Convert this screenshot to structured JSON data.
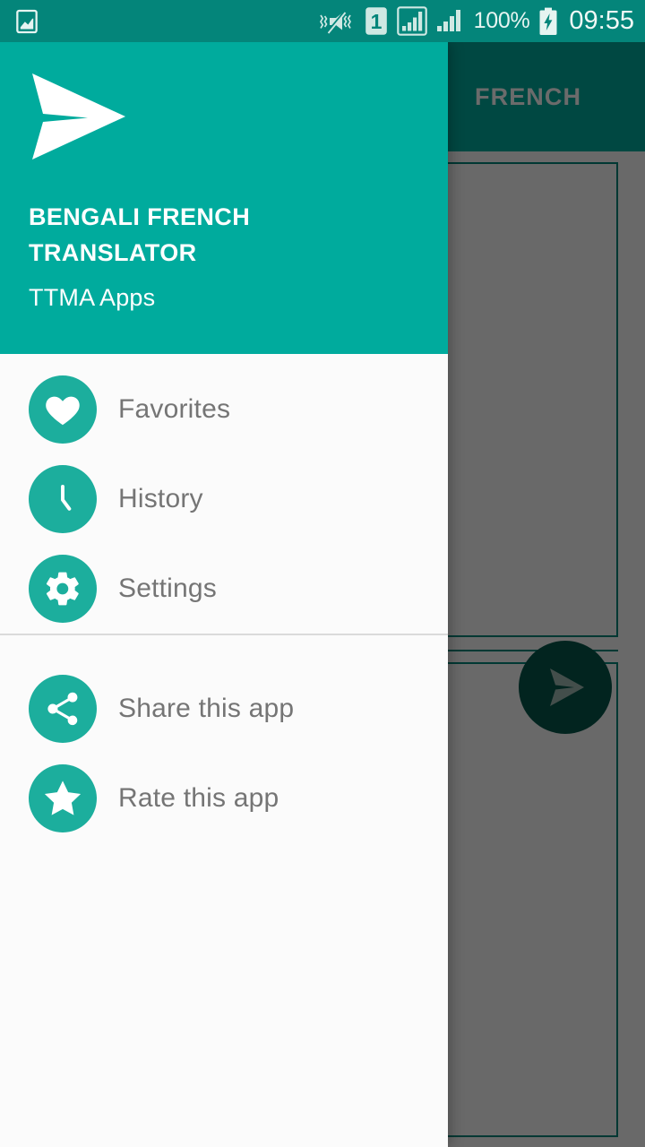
{
  "status_bar": {
    "left_icon": "photo-gallery-icon",
    "icons": [
      "vibrate-mute-icon",
      "sim-1-icon",
      "signal-bars-sim1-icon",
      "signal-bars-sim2-icon"
    ],
    "battery_percent": "100%",
    "battery_icon": "battery-charging-icon",
    "clock": "09:55",
    "background_color": "#04857a",
    "foreground_color": "#e6f4f1"
  },
  "app_bar": {
    "title": "FRENCH",
    "background_color": "#00ab9d",
    "title_color": "#ffffff"
  },
  "main": {
    "source_panel_label": "",
    "target_panel_label": "",
    "fab_icon": "send-paper-plane-icon",
    "fab_color": "#05564a",
    "panel_border_color": "#00857a"
  },
  "scrim": {
    "color": "#000000",
    "opacity": "0.58"
  },
  "drawer": {
    "logo_icon": "send-paper-plane-logo-icon",
    "title": "BENGALI FRENCH TRANSLATOR",
    "subtitle": "TTMA Apps",
    "header_background": "#00ab9d",
    "background": "#fbfbfb",
    "accent_color": "#1cae9d",
    "label_color": "#757575",
    "groups": [
      {
        "items": [
          {
            "label": "Favorites",
            "icon": "heart-icon"
          },
          {
            "label": "History",
            "icon": "clock-icon"
          },
          {
            "label": "Settings",
            "icon": "gear-icon"
          }
        ]
      },
      {
        "items": [
          {
            "label": "Share this app",
            "icon": "share-icon"
          },
          {
            "label": "Rate this app",
            "icon": "star-icon"
          }
        ]
      }
    ]
  }
}
